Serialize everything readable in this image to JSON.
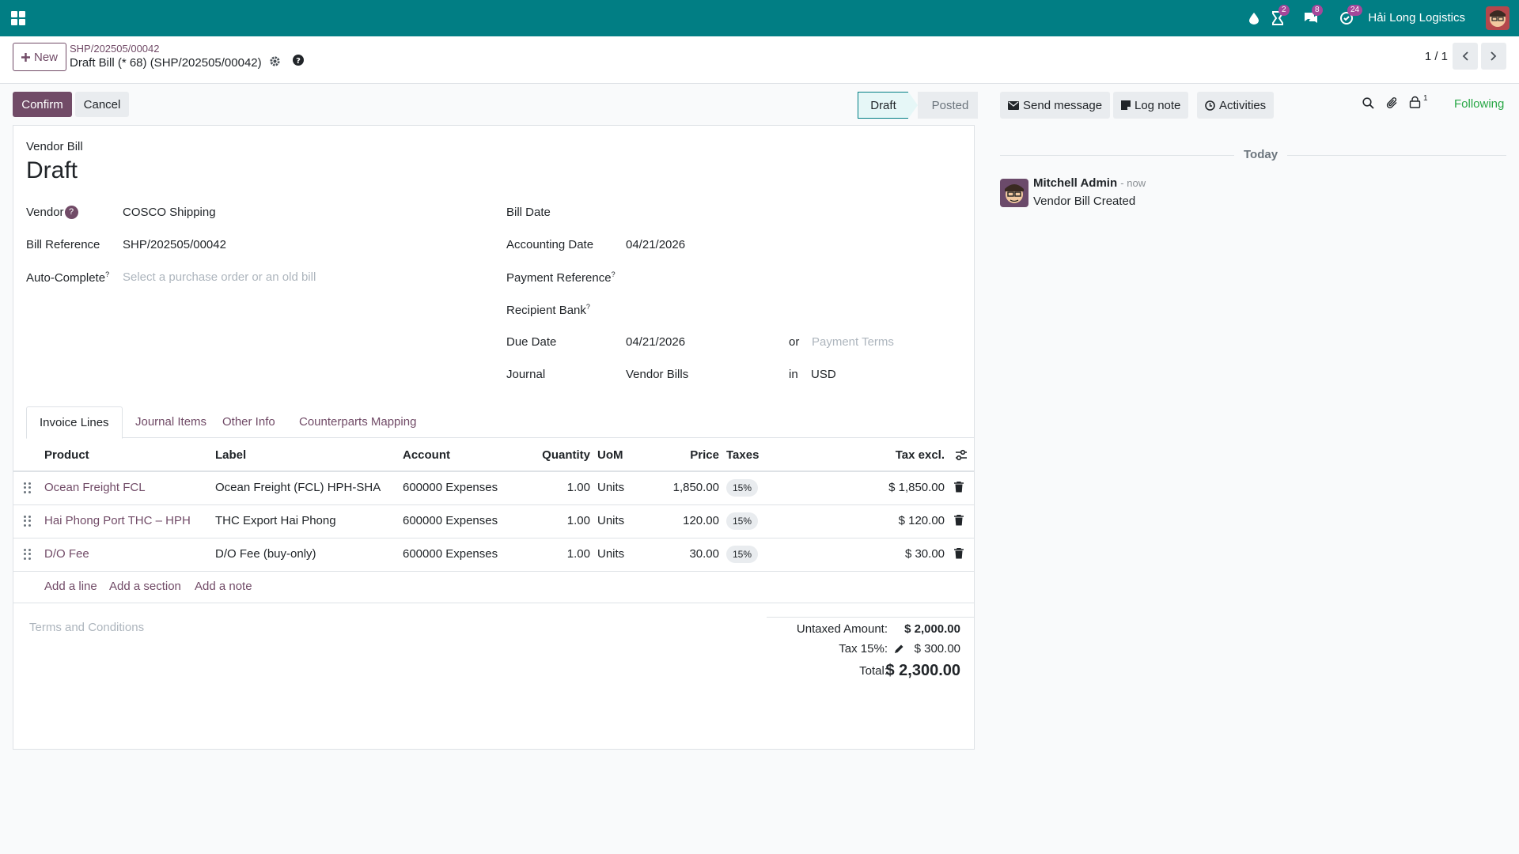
{
  "navbar": {
    "company": "Hải Long Logistics",
    "badges": {
      "activities": "2",
      "messages": "8",
      "updates": "24"
    }
  },
  "control": {
    "new_label": "New",
    "breadcrumb_parent": "SHP/202505/00042",
    "breadcrumb_title": "Draft Bill (* 68) (SHP/202505/00042)",
    "pager": "1 / 1"
  },
  "actions": {
    "confirm": "Confirm",
    "cancel": "Cancel"
  },
  "status": {
    "draft": "Draft",
    "posted": "Posted"
  },
  "form": {
    "doc_type": "Vendor Bill",
    "state_title": "Draft",
    "vendor_label": "Vendor",
    "vendor_value": "COSCO Shipping",
    "bill_ref_label": "Bill Reference",
    "bill_ref_value": "SHP/202505/00042",
    "autocomplete_label": "Auto-Complete",
    "autocomplete_placeholder": "Select a purchase order or an old bill",
    "bill_date_label": "Bill Date",
    "accounting_date_label": "Accounting Date",
    "accounting_date_value": "04/21/2026",
    "payment_ref_label": "Payment Reference",
    "recipient_bank_label": "Recipient Bank",
    "due_date_label": "Due Date",
    "due_date_value": "04/21/2026",
    "or_text": "or",
    "payment_terms_placeholder": "Payment Terms",
    "journal_label": "Journal",
    "journal_value": "Vendor Bills",
    "in_text": "in",
    "currency_value": "USD",
    "help_mark": "?"
  },
  "tabs": [
    "Invoice Lines",
    "Journal Items",
    "Other Info",
    "Counterparts Mapping"
  ],
  "table": {
    "headers": {
      "product": "Product",
      "label": "Label",
      "account": "Account",
      "quantity": "Quantity",
      "uom": "UoM",
      "price": "Price",
      "taxes": "Taxes",
      "tax_excl": "Tax excl."
    },
    "rows": [
      {
        "product": "Ocean Freight FCL",
        "label": "Ocean Freight (FCL) HPH-SHA",
        "account": "600000 Expenses",
        "quantity": "1.00",
        "uom": "Units",
        "price": "1,850.00",
        "tax": "15%",
        "subtotal": "$ 1,850.00"
      },
      {
        "product": "Hai Phong Port THC – HPH",
        "label": "THC Export Hai Phong",
        "account": "600000 Expenses",
        "quantity": "1.00",
        "uom": "Units",
        "price": "120.00",
        "tax": "15%",
        "subtotal": "$ 120.00"
      },
      {
        "product": "D/O Fee",
        "label": "D/O Fee (buy-only)",
        "account": "600000 Expenses",
        "quantity": "1.00",
        "uom": "Units",
        "price": "30.00",
        "tax": "15%",
        "subtotal": "$ 30.00"
      }
    ],
    "add_line": "Add a line",
    "add_section": "Add a section",
    "add_note": "Add a note"
  },
  "terms_placeholder": "Terms and Conditions",
  "totals": {
    "untaxed_label": "Untaxed Amount:",
    "untaxed_value": "$ 2,000.00",
    "tax_label": "Tax 15%:",
    "tax_value": "$ 300.00",
    "total_label": "Total:",
    "total_value": "$ 2,300.00"
  },
  "chatter": {
    "send_message": "Send message",
    "log_note": "Log note",
    "activities": "Activities",
    "followers_count": "1",
    "following": "Following",
    "today": "Today",
    "message": {
      "author": "Mitchell Admin",
      "time": "- now",
      "body": "Vendor Bill Created"
    }
  },
  "colors": {
    "brand": "#017e84",
    "primary": "#714b67",
    "following": "#28a745"
  }
}
